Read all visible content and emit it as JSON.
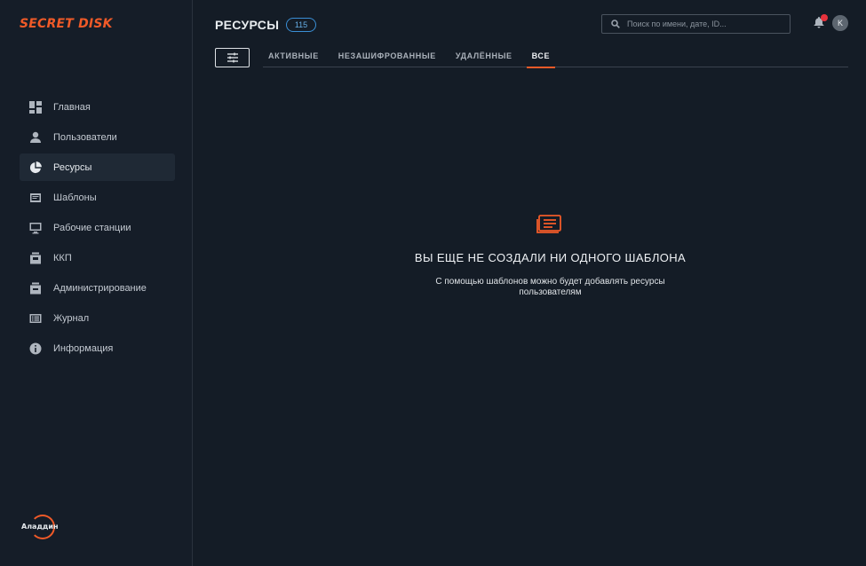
{
  "app": {
    "logo_text": "SECRET DISK",
    "brand_text": "Аладдин",
    "accent_color": "#f05a28"
  },
  "sidebar": {
    "items": [
      {
        "label": "Главная",
        "icon": "dashboard-icon",
        "active": false
      },
      {
        "label": "Пользователи",
        "icon": "user-icon",
        "active": false
      },
      {
        "label": "Ресурсы",
        "icon": "pie-chart-icon",
        "active": true
      },
      {
        "label": "Шаблоны",
        "icon": "template-icon",
        "active": false
      },
      {
        "label": "Рабочие станции",
        "icon": "monitor-icon",
        "active": false
      },
      {
        "label": "ККП",
        "icon": "kiosk-icon",
        "active": false
      },
      {
        "label": "Администрирование",
        "icon": "admin-icon",
        "active": false
      },
      {
        "label": "Журнал",
        "icon": "journal-icon",
        "active": false
      },
      {
        "label": "Информация",
        "icon": "info-icon",
        "active": false
      }
    ]
  },
  "header": {
    "title": "РЕСУРСЫ",
    "count": "115",
    "search_placeholder": "Поиск по имени, дате, ID...",
    "avatar_initial": "K"
  },
  "tabs": [
    {
      "label": "АКТИВНЫЕ",
      "active": false
    },
    {
      "label": "НЕЗАШИФРОВАННЫЕ",
      "active": false
    },
    {
      "label": "УДАЛЁННЫЕ",
      "active": false
    },
    {
      "label": "ВСЕ",
      "active": true
    }
  ],
  "empty_state": {
    "icon": "template-stack-icon",
    "title": "ВЫ ЕЩЕ НЕ СОЗДАЛИ НИ ОДНОГО ШАБЛОНА",
    "description": "С помощью шаблонов можно будет добавлять ресурсы пользователям"
  }
}
